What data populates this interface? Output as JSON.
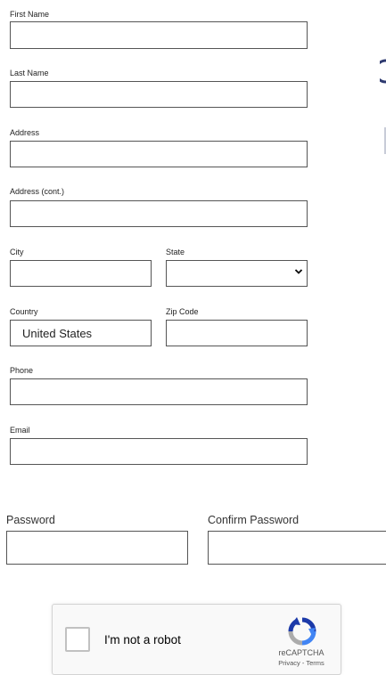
{
  "form": {
    "first_name_label": "First Name",
    "last_name_label": "Last Name",
    "address_label": "Address",
    "address2_label": "Address (cont.)",
    "city_label": "City",
    "state_label": "State",
    "state_value": "",
    "country_label": "Country",
    "country_value": "United States",
    "zip_label": "Zip Code",
    "phone_label": "Phone",
    "email_label": "Email",
    "password_label": "Password",
    "confirm_password_label": "Confirm Password"
  },
  "captcha": {
    "label": "I'm not a robot",
    "brand": "reCAPTCHA",
    "links": "Privacy - Terms"
  }
}
